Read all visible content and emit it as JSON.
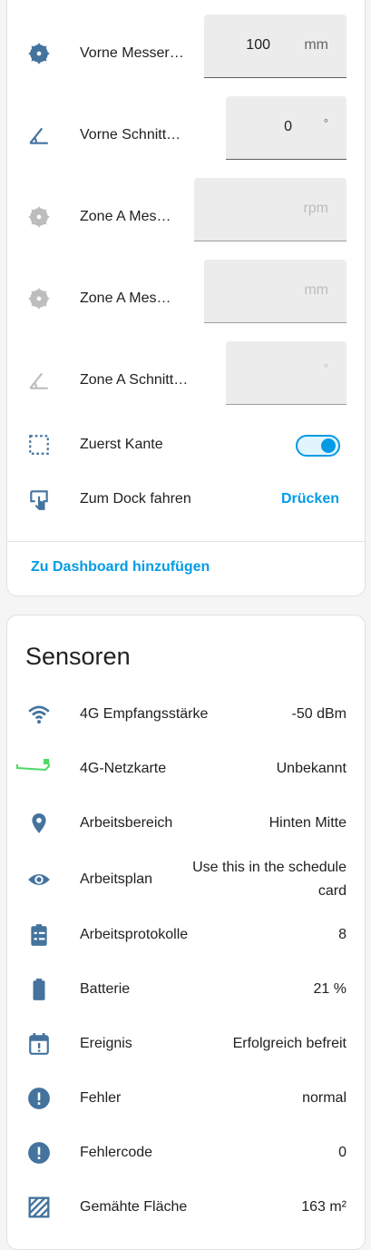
{
  "settings": {
    "vorne_messer": {
      "label": "Vorne Messerhöhe",
      "value": "100",
      "unit": "mm",
      "icon": "saw-blade-icon"
    },
    "vorne_schnitt": {
      "label": "Vorne Schnittwinkel",
      "value": "0",
      "unit": "°",
      "icon": "angle-acute-icon"
    },
    "zone_a_rpm": {
      "label": "Zone A Messerdrehzahl",
      "value": "",
      "unit": "rpm",
      "icon": "saw-blade-icon"
    },
    "zone_a_mm": {
      "label": "Zone A Messerhöhe",
      "value": "",
      "unit": "mm",
      "icon": "saw-blade-icon"
    },
    "zone_a_winkel": {
      "label": "Zone A Schnittwinkel",
      "value": "",
      "unit": "°",
      "icon": "angle-acute-icon"
    },
    "zuerst_kante": {
      "label": "Zuerst Kante",
      "on": true,
      "icon": "selection-icon"
    },
    "dock": {
      "label": "Zum Dock fahren",
      "action": "Drücken",
      "icon": "gesture-tap-icon"
    },
    "add_dashboard": "Zu Dashboard hinzufügen"
  },
  "sensors": {
    "title": "Sensoren",
    "items": [
      {
        "label": "4G Empfangsstärke",
        "value": "-50 dBm",
        "icon": "wifi-icon"
      },
      {
        "label": "4G-Netzkarte",
        "value": "Unbekannt",
        "icon": "sim-card-icon"
      },
      {
        "label": "Arbeitsbereich",
        "value": "Hinten Mitte",
        "icon": "map-marker-icon"
      },
      {
        "label": "Arbeitsplan",
        "value": "Use this in the schedule card",
        "icon": "eye-icon"
      },
      {
        "label": "Arbeitsprotokolle",
        "value": "8",
        "icon": "clipboard-list-icon"
      },
      {
        "label": "Batterie",
        "value": "21 %",
        "icon": "battery-icon"
      },
      {
        "label": "Ereignis",
        "value": "Erfolgreich befreit",
        "icon": "calendar-alert-icon"
      },
      {
        "label": "Fehler",
        "value": "normal",
        "icon": "alert-circle-icon"
      },
      {
        "label": "Fehlercode",
        "value": "0",
        "icon": "alert-circle-icon"
      },
      {
        "label": "Gemähte Fläche",
        "value": "163 m²",
        "icon": "texture-box-icon"
      }
    ]
  },
  "colors": {
    "accent": "#039be5",
    "icon": "#44739e",
    "icon_disabled": "#bdbdbd",
    "sim": "#4cd964"
  }
}
